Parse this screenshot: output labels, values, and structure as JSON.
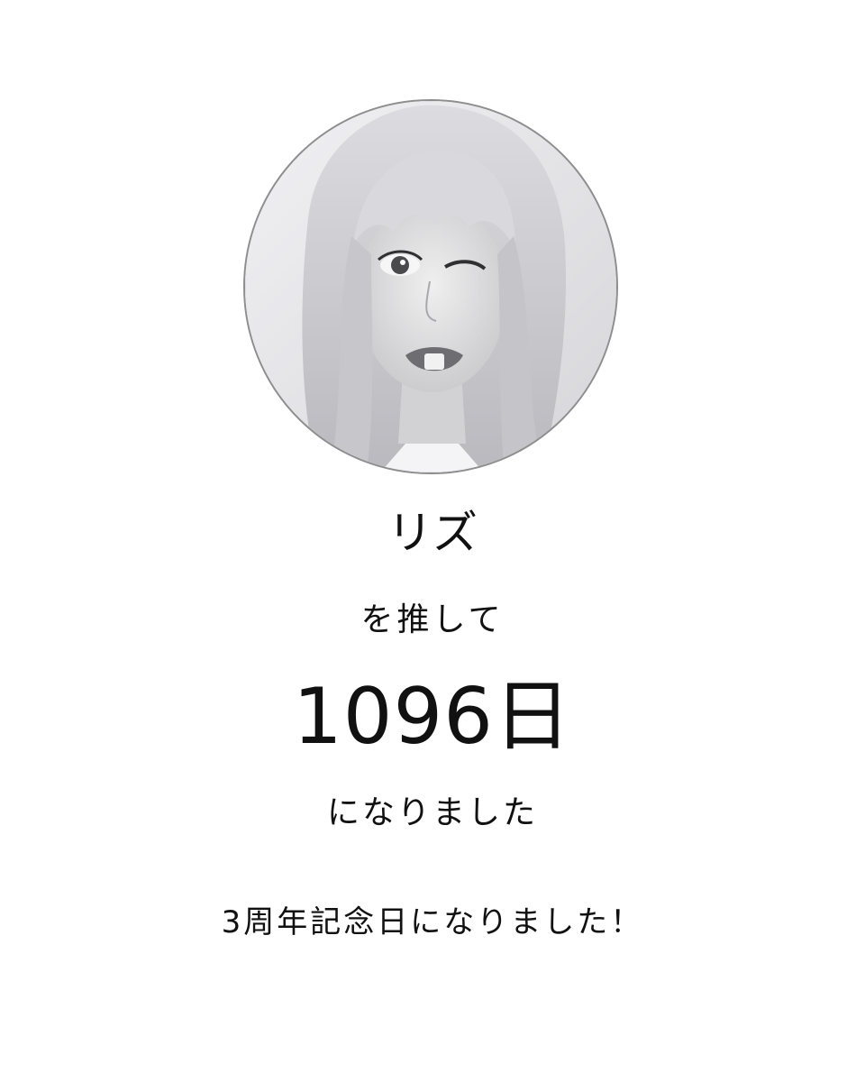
{
  "profile": {
    "name": "リズ",
    "photo_icon": "avatar-photo-icon"
  },
  "counter": {
    "prefix": "を推して",
    "days": "1096日",
    "suffix": "になりました"
  },
  "message": "3周年記念日になりました！"
}
